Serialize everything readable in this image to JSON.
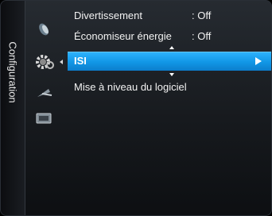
{
  "sidebar": {
    "title": "Configuration"
  },
  "icons": [
    {
      "name": "picture-icon"
    },
    {
      "name": "settings-gear-icon"
    },
    {
      "name": "satellite-dish-icon"
    },
    {
      "name": "input-icon"
    }
  ],
  "menu": {
    "items": [
      {
        "label": "Divertissement",
        "value": ": Off"
      },
      {
        "label": "Économiseur énergie",
        "value": ": Off"
      },
      {
        "label": "ISI",
        "value": "",
        "selected": true
      },
      {
        "label": "Mise à niveau du logiciel",
        "value": ""
      }
    ]
  },
  "colors": {
    "highlight": "#1197e6",
    "text": "#f2f2f2",
    "background": "#171a1e"
  }
}
